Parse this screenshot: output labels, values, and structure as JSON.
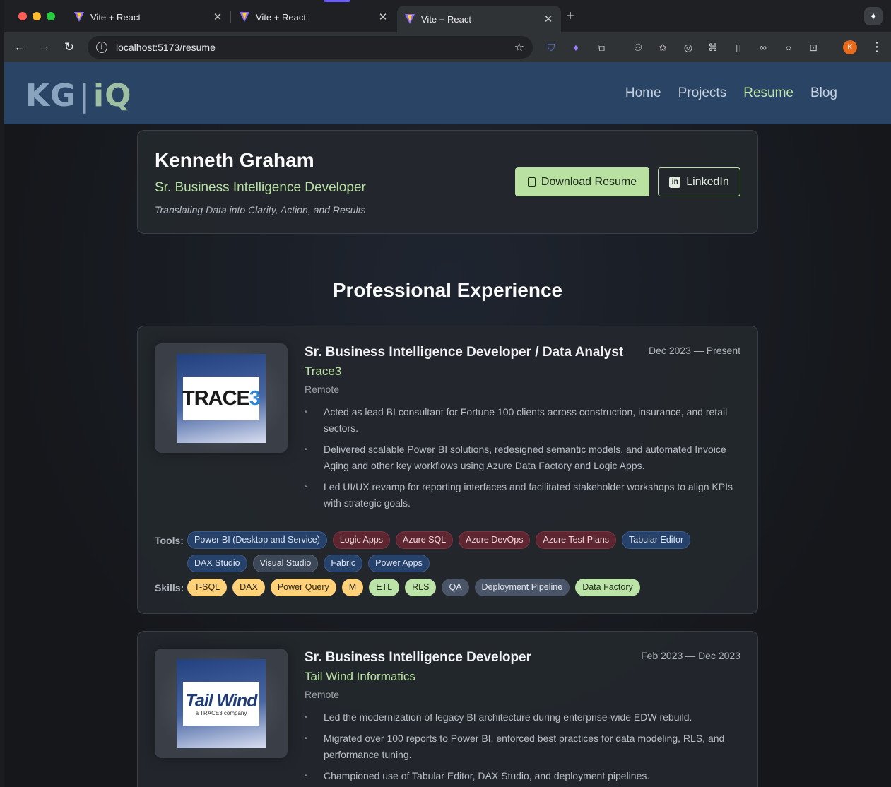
{
  "browser": {
    "tabs": [
      {
        "title": "Vite + React",
        "active": false
      },
      {
        "title": "Vite + React",
        "active": false
      },
      {
        "title": "Vite + React",
        "active": true
      }
    ],
    "url": "localhost:5173/resume",
    "profile_initial": "K"
  },
  "site": {
    "logo_left": "KG",
    "logo_right": "iQ",
    "nav": [
      {
        "label": "Home",
        "active": false
      },
      {
        "label": "Projects",
        "active": false
      },
      {
        "label": "Resume",
        "active": true
      },
      {
        "label": "Blog",
        "active": false
      }
    ]
  },
  "hero": {
    "name": "Kenneth Graham",
    "role": "Sr. Business Intelligence Developer",
    "tagline": "Translating Data into Clarity, Action, and Results",
    "download_label": "Download Resume",
    "linkedin_label": "LinkedIn"
  },
  "experience_title": "Professional Experience",
  "labels": {
    "tools": "Tools:",
    "skills": "Skills:"
  },
  "jobs": [
    {
      "title": "Sr. Business Intelligence Developer / Data Analyst",
      "company": "Trace3",
      "location": "Remote",
      "dates": "Dec 2023 — Present",
      "logo_text": "TRACE3",
      "bullets": [
        "Acted as lead BI consultant for Fortune 100 clients across construction, insurance, and retail sectors.",
        "Delivered scalable Power BI solutions, redesigned semantic models, and automated Invoice Aging and other key workflows using Azure Data Factory and Logic Apps.",
        "Led UI/UX revamp for reporting interfaces and facilitated stakeholder workshops to align KPIs with strategic goals."
      ],
      "tools": [
        {
          "label": "Power BI (Desktop and Service)",
          "color": "blue"
        },
        {
          "label": "Logic Apps",
          "color": "red"
        },
        {
          "label": "Azure SQL",
          "color": "red"
        },
        {
          "label": "Azure DevOps",
          "color": "red"
        },
        {
          "label": "Azure Test Plans",
          "color": "red"
        },
        {
          "label": "Tabular Editor",
          "color": "blue"
        },
        {
          "label": "DAX Studio",
          "color": "blue"
        },
        {
          "label": "Visual Studio",
          "color": "slate"
        },
        {
          "label": "Fabric",
          "color": "blue"
        },
        {
          "label": "Power Apps",
          "color": "blue"
        }
      ],
      "skills": [
        {
          "label": "T-SQL",
          "color": "yellow"
        },
        {
          "label": "DAX",
          "color": "yellow"
        },
        {
          "label": "Power Query",
          "color": "yellow"
        },
        {
          "label": "M",
          "color": "yellow"
        },
        {
          "label": "ETL",
          "color": "green"
        },
        {
          "label": "RLS",
          "color": "green"
        },
        {
          "label": "QA",
          "color": "gray"
        },
        {
          "label": "Deployment Pipeline",
          "color": "gray"
        },
        {
          "label": "Data Factory",
          "color": "green"
        }
      ]
    },
    {
      "title": "Sr. Business Intelligence Developer",
      "company": "Tail Wind Informatics",
      "location": "Remote",
      "dates": "Feb 2023 — Dec 2023",
      "logo_text": "Tail Wind",
      "logo_sub": "a TRACE3 company",
      "bullets": [
        "Led the modernization of legacy BI architecture during enterprise-wide EDW rebuild.",
        "Migrated over 100 reports to Power BI, enforced best practices for data modeling, RLS, and performance tuning.",
        "Championed use of Tabular Editor, DAX Studio, and deployment pipelines."
      ]
    }
  ]
}
